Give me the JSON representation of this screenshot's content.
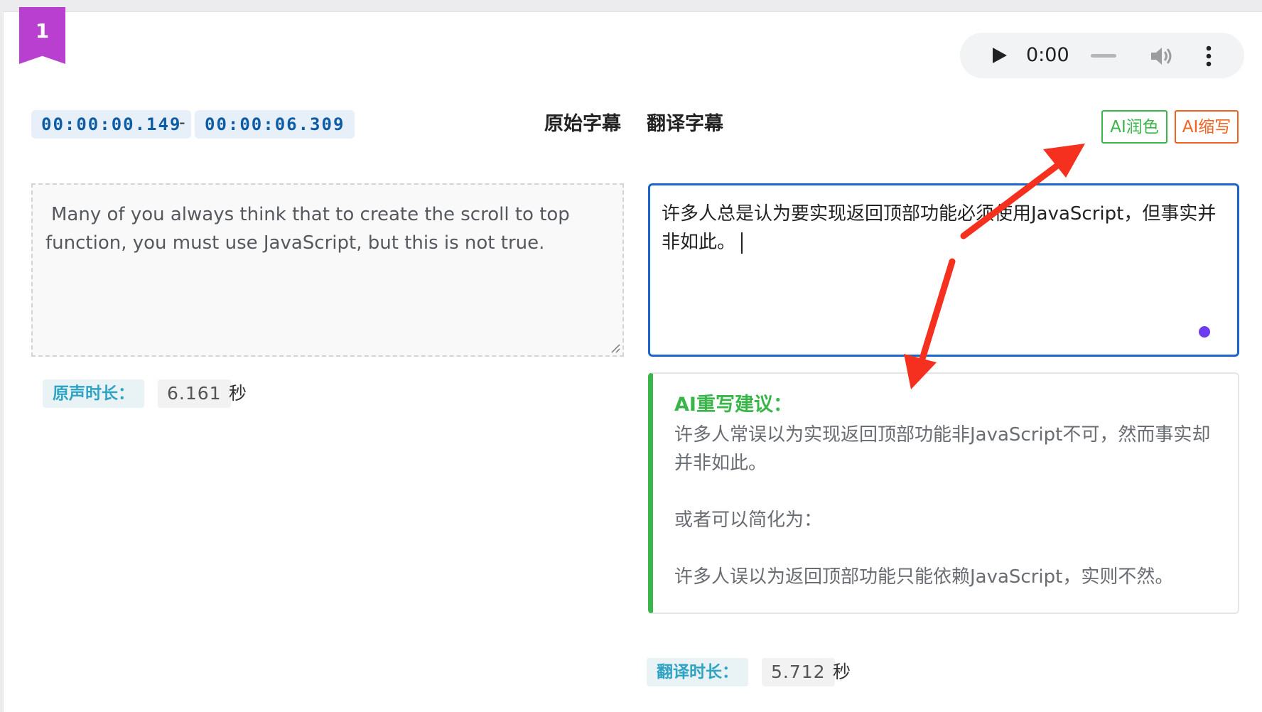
{
  "segment": {
    "index": "1"
  },
  "audio": {
    "time": "0:00"
  },
  "timestamps": {
    "start": "00:00:00.149",
    "separator": "-",
    "end": "00:00:06.309"
  },
  "columns": {
    "original": "原始字幕",
    "translated": "翻译字幕"
  },
  "actions": {
    "polish": "AI润色",
    "shorten": "AI缩写"
  },
  "original_text": "Many of you always think that to create the scroll to top function, you must use JavaScript, but this is not true.",
  "translated_text": "许多人总是认为要实现返回顶部功能必须使用JavaScript，但事实并非如此。",
  "suggestion": {
    "title": "AI重写建议：",
    "body": "许多人常误以为实现返回顶部功能非JavaScript不可，然而事实却并非如此。\n\n或者可以简化为：\n\n许多人误以为返回顶部功能只能依赖JavaScript，实则不然。"
  },
  "original_duration": {
    "label": "原声时长：",
    "value": "6.161",
    "unit": "秒"
  },
  "translated_duration": {
    "label": "翻译时长：",
    "value": "5.712",
    "unit": "秒"
  },
  "colors": {
    "bookmark": "#b83fcf",
    "timestamp_text": "#0d5ca6",
    "polish": "#3ab54a",
    "shorten": "#f0621f",
    "focus_border": "#1b64c9",
    "annotation_arrow": "#f5301e",
    "duration_label": "#2fa3c3"
  },
  "icons": {
    "play": "play-icon",
    "volume": "volume-icon",
    "more": "more-vertical-icon",
    "resize": "resize-handle-icon"
  }
}
